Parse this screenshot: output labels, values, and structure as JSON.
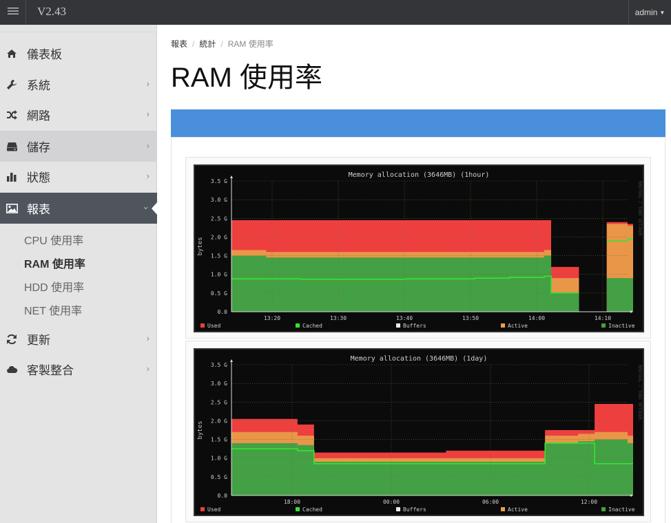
{
  "topbar": {
    "version": "V2.43",
    "user": "admin"
  },
  "sidebar": {
    "items": [
      {
        "label": "儀表板",
        "icon": "home-icon"
      },
      {
        "label": "系統",
        "icon": "wrench-icon"
      },
      {
        "label": "網路",
        "icon": "shuffle-icon"
      },
      {
        "label": "儲存",
        "icon": "hdd-icon"
      },
      {
        "label": "狀態",
        "icon": "bar-chart-icon"
      },
      {
        "label": "報表",
        "icon": "image-icon"
      },
      {
        "label": "更新",
        "icon": "refresh-icon"
      },
      {
        "label": "客製整合",
        "icon": "cloud-icon"
      }
    ],
    "report_sub": [
      "CPU 使用率",
      "RAM 使用率",
      "HDD 使用率",
      "NET 使用率"
    ]
  },
  "breadcrumb": [
    "報表",
    "統計",
    "RAM 使用率"
  ],
  "page_title": "RAM 使用率",
  "colors": {
    "used": "#ee3f3f",
    "cached": "#33e633",
    "buffers": "#ebebeb",
    "active": "#e8a04a",
    "inactive": "#44a044",
    "accent": "#4a8fdb"
  },
  "chart_data": [
    {
      "type": "area",
      "title": "Memory allocation (3646MB)  (1hour)",
      "ylabel": "bytes",
      "y_ticks": [
        "0.0",
        "0.5 G",
        "1.0 G",
        "1.5 G",
        "2.0 G",
        "2.5 G",
        "3.0 G",
        "3.5 G"
      ],
      "x_ticks": [
        "13:20",
        "13:30",
        "13:40",
        "13:50",
        "14:00",
        "14:10"
      ],
      "ylim": [
        0,
        3.5
      ],
      "watermark": "RRDTOOL / TOBI OETIKER",
      "legend": [
        "Used",
        "Cached",
        "Buffers",
        "Active",
        "Inactive"
      ],
      "x": [
        "13:15",
        "13:20",
        "13:25",
        "13:30",
        "13:35",
        "13:40",
        "13:45",
        "13:50",
        "13:55",
        "14:00",
        "14:01",
        "14:05",
        "14:09",
        "14:12"
      ],
      "series": [
        {
          "name": "Used",
          "values": [
            2.45,
            2.45,
            2.45,
            2.45,
            2.45,
            2.45,
            2.45,
            2.45,
            2.45,
            2.45,
            1.2,
            null,
            2.4,
            2.35
          ]
        },
        {
          "name": "Active",
          "values": [
            1.65,
            1.6,
            1.6,
            1.6,
            1.6,
            1.6,
            1.6,
            1.6,
            1.6,
            1.65,
            0.9,
            null,
            2.35,
            2.3
          ]
        },
        {
          "name": "Inactive",
          "values": [
            1.5,
            1.45,
            1.45,
            1.45,
            1.45,
            1.45,
            1.45,
            1.45,
            1.45,
            1.5,
            0.5,
            null,
            0.9,
            0.9
          ]
        },
        {
          "name": "Cached",
          "values": [
            0.88,
            0.88,
            0.87,
            0.87,
            0.87,
            0.88,
            0.88,
            0.9,
            0.92,
            0.95,
            0.5,
            null,
            1.9,
            1.95
          ]
        }
      ]
    },
    {
      "type": "area",
      "title": "Memory allocation (3646MB)  (1day)",
      "ylabel": "bytes",
      "y_ticks": [
        "0.0",
        "0.5 G",
        "1.0 G",
        "1.5 G",
        "2.0 G",
        "2.5 G",
        "3.0 G",
        "3.5 G"
      ],
      "x_ticks": [
        "18:00",
        "00:00",
        "06:00",
        "12:00"
      ],
      "ylim": [
        0,
        3.5
      ],
      "watermark": "RRDTOOL / TOBI OETIKER",
      "legend": [
        "Used",
        "Cached",
        "Buffers",
        "Active",
        "Inactive"
      ],
      "x": [
        "14:00",
        "18:00",
        "19:00",
        "00:00",
        "03:00",
        "09:00",
        "11:00",
        "12:00",
        "14:00"
      ],
      "series": [
        {
          "name": "Used",
          "values": [
            2.05,
            1.9,
            1.15,
            1.15,
            1.2,
            1.75,
            1.75,
            2.45,
            2.45
          ]
        },
        {
          "name": "Active",
          "values": [
            1.7,
            1.6,
            1.0,
            1.0,
            1.0,
            1.6,
            1.65,
            1.7,
            1.6
          ]
        },
        {
          "name": "Inactive",
          "values": [
            1.4,
            1.35,
            0.9,
            0.9,
            0.9,
            1.4,
            1.45,
            1.5,
            1.4
          ]
        },
        {
          "name": "Cached",
          "values": [
            1.25,
            1.2,
            0.85,
            0.85,
            0.85,
            1.4,
            1.4,
            0.85,
            0.85
          ]
        }
      ]
    }
  ]
}
